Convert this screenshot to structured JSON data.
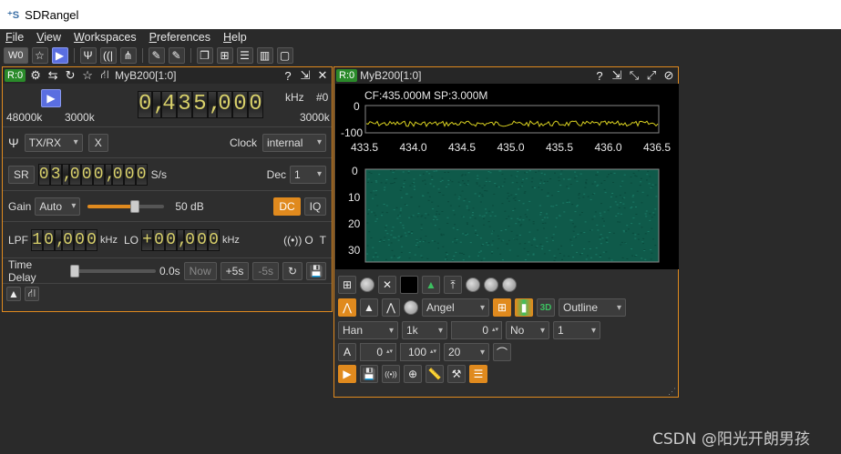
{
  "app": {
    "title": "SDRangel"
  },
  "menu": [
    "File",
    "View",
    "Workspaces",
    "Preferences",
    "Help"
  ],
  "toolbar": {
    "workspace_label": "W0"
  },
  "device_win": {
    "badge": "R:0",
    "device_name": "MyB200[1:0]",
    "freq_digits": [
      "0",
      ",",
      "4",
      "3",
      "5",
      ",",
      "0",
      "0",
      "0"
    ],
    "freq_unit": "kHz",
    "freq_index": "#0",
    "sr_left": "48000k",
    "sr_mid": "3000k",
    "sr_right": "3000k",
    "antenna": "TX/RX",
    "x_label": "X",
    "clock_label": "Clock",
    "clock_value": "internal",
    "sr_label": "SR",
    "sr_digits": [
      "0",
      "3",
      ",",
      "0",
      "0",
      "0",
      ",",
      "0",
      "0",
      "0"
    ],
    "sr_unit": "S/s",
    "dec_label": "Dec",
    "dec_value": "1",
    "gain_label": "Gain",
    "gain_mode": "Auto",
    "gain_value": "50 dB",
    "gain_level": 0.62,
    "dc_label": "DC",
    "iq_label": "IQ",
    "lpf_label": "LPF",
    "lpf_digits": [
      "1",
      "0",
      ",",
      "0",
      "0",
      "0"
    ],
    "lpf_unit": "kHz",
    "lo_label": "LO",
    "lo_digits": [
      "+",
      "0",
      "0",
      ",",
      "0",
      "0",
      "0"
    ],
    "lo_unit": "kHz",
    "o_label": "O",
    "t_label": "T",
    "time_delay_label": "Time Delay",
    "time_delay_value": "0.0s",
    "now_label": "Now",
    "plus5_label": "+5s",
    "minus5_label": "-5s"
  },
  "spectrum_win": {
    "badge": "R:0",
    "device_name": "MyB200[1:0]",
    "cf_sp": "CF:435.000M SP:3.000M",
    "y_ticks": [
      "0",
      "-100"
    ],
    "x_ticks": [
      "433.5",
      "434.0",
      "434.5",
      "435.0",
      "435.5",
      "436.0",
      "436.5"
    ],
    "wf_ticks": [
      "0",
      "10",
      "20",
      "30"
    ],
    "palette": "Angel",
    "display_mode": "Outline",
    "window_fn": "Han",
    "fft_size": "1k",
    "overlap": "0",
    "avg_mode": "No",
    "avg_n": "1",
    "a_label": "A",
    "ref_level": "0",
    "range": "100",
    "rate": "20"
  },
  "watermark": "CSDN @阳光开朗男孩",
  "colors": {
    "accent": "#e08a1e",
    "badge": "#2a8a2a",
    "trace": "#d8d020",
    "waterfall": "#0f5a4a"
  }
}
